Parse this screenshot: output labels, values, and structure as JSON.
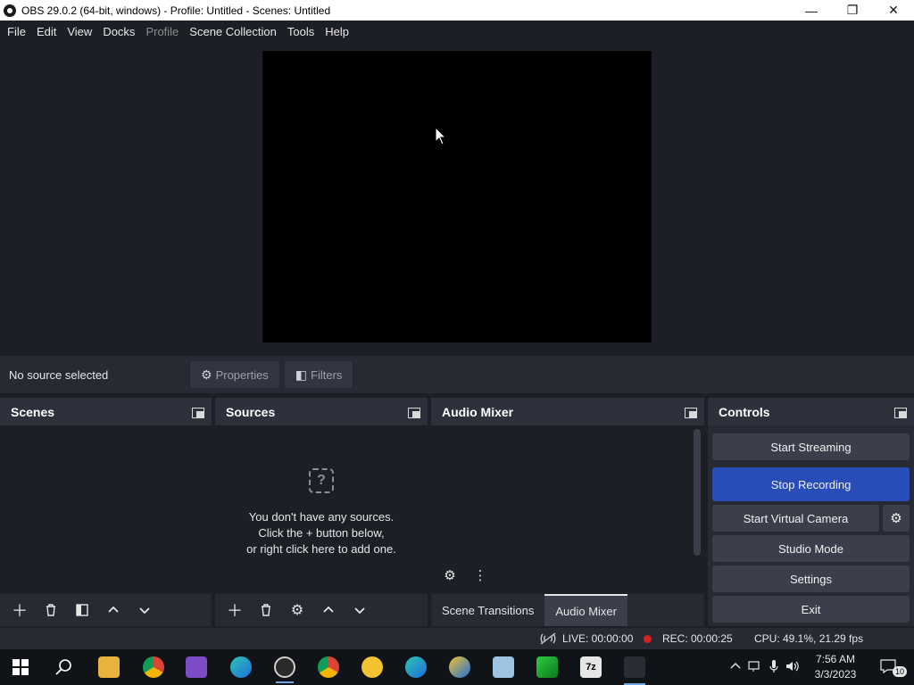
{
  "window": {
    "title": "OBS 29.0.2 (64-bit, windows) - Profile: Untitled - Scenes: Untitled",
    "controls": {
      "minimize": "—",
      "maximize": "❐",
      "close": "✕"
    }
  },
  "menu": [
    "File",
    "Edit",
    "View",
    "Docks",
    "Profile",
    "Scene Collection",
    "Tools",
    "Help"
  ],
  "source_bar": {
    "status": "No source selected",
    "properties_label": "Properties",
    "filters_label": "Filters"
  },
  "docks": {
    "scenes": {
      "title": "Scenes"
    },
    "sources": {
      "title": "Sources",
      "empty_line1": "You don't have any sources.",
      "empty_line2": "Click the + button below,",
      "empty_line3": "or right click here to add one."
    },
    "mixer": {
      "title": "Audio Mixer",
      "tab_transitions": "Scene Transitions",
      "tab_mixer": "Audio Mixer"
    },
    "controls": {
      "title": "Controls",
      "start_streaming": "Start Streaming",
      "stop_recording": "Stop Recording",
      "start_virtual_camera": "Start Virtual Camera",
      "studio_mode": "Studio Mode",
      "settings": "Settings",
      "exit": "Exit"
    }
  },
  "status": {
    "live": "LIVE: 00:00:00",
    "rec": "REC: 00:00:25",
    "cpu": "CPU: 49.1%, 21.29 fps"
  },
  "taskbar": {
    "time": "7:56 AM",
    "date": "3/3/2023",
    "notifications": "10"
  },
  "colors": {
    "background": "#1d1f26",
    "panel": "#272a33",
    "button": "#3b3f4b",
    "accent_active": "#284cb8",
    "rec_dot": "#d61f1f"
  }
}
